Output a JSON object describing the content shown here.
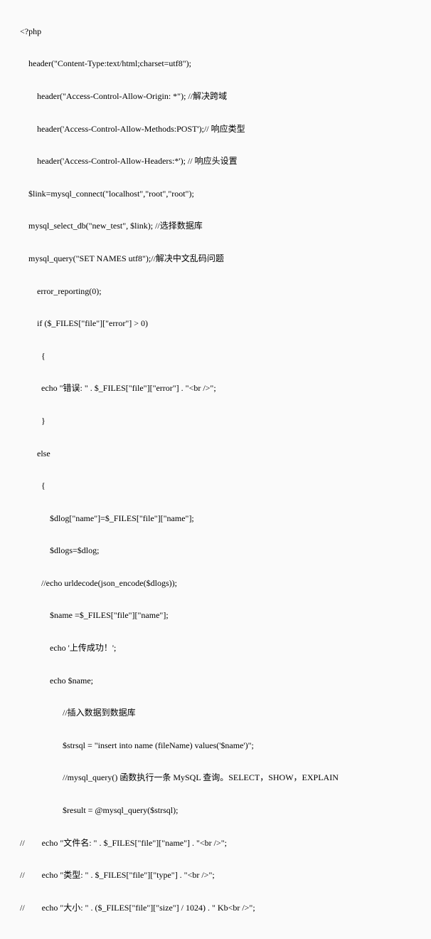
{
  "code": {
    "lines": [
      "<?php  ",
      "    header(\"Content-Type:text/html;charset=utf8\"); ",
      "        header(\"Access-Control-Allow-Origin: *\"); //解决跨域",
      "        header('Access-Control-Allow-Methods:POST');// 响应类型  ",
      "        header('Access-Control-Allow-Headers:*'); // 响应头设置 ",
      "    $link=mysql_connect(\"localhost\",\"root\",\"root\"); ",
      "    mysql_select_db(\"new_test\", $link); //选择数据库",
      "    mysql_query(\"SET NAMES utf8\");//解决中文乱码问题",
      "        error_reporting(0);",
      "        if ($_FILES[\"file\"][\"error\"] > 0)",
      "          {",
      "          echo \"错误: \" . $_FILES[\"file\"][\"error\"] . \"<br />\";",
      "          }",
      "        else",
      "          {",
      "              $dlog[\"name\"]=$_FILES[\"file\"][\"name\"];",
      "              $dlogs=$dlog;",
      "          //echo urldecode(json_encode($dlogs));",
      "              $name =$_FILES[\"file\"][\"name\"];",
      "              echo '上传成功！';",
      "              echo $name;",
      "                    //插入数据到数据库  ",
      "                    $strsql = \"insert into name (fileName) values('$name')\";  ",
      "                    //mysql_query() 函数执行一条 MySQL 查询。SELECT，SHOW，EXPLAIN",
      "                    $result = @mysql_query($strsql);",
      "//        echo \"文件名: \" . $_FILES[\"file\"][\"name\"] . \"<br />\";",
      "//        echo \"类型: \" . $_FILES[\"file\"][\"type\"] . \"<br />\";",
      "//        echo \"大小: \" . ($_FILES[\"file\"][\"size\"] / 1024) . \" Kb<br />\";"
    ]
  }
}
